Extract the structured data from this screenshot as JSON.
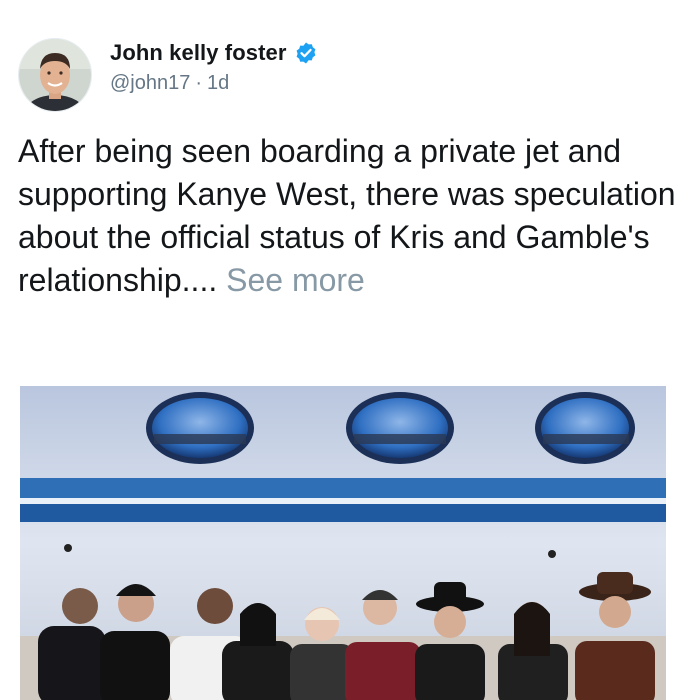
{
  "tweet": {
    "author": {
      "display_name": "John kelly foster",
      "handle": "@john17",
      "verified": true,
      "verified_icon": "verified-badge-icon",
      "verified_color": "#1da1f2"
    },
    "timestamp": "1d",
    "separator": "·",
    "text": "After being seen boarding a private jet and supporting Kanye West, there was speculation about the official status of Kris and Gamble's relationship....",
    "see_more_label": "See more",
    "media": {
      "type": "photo"
    }
  },
  "colors": {
    "text": "#14171a",
    "secondary": "#657786",
    "link_muted": "#8899a6",
    "jet_stripe": "#2f6fb5"
  }
}
